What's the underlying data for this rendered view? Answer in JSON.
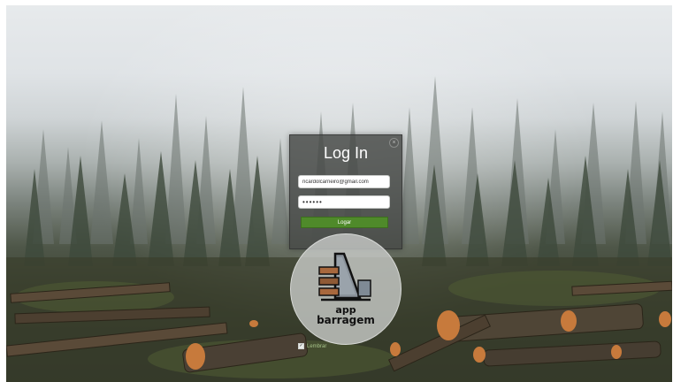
{
  "login": {
    "title": "Log In",
    "email_value": "ricardolcarneiro@gmail.com",
    "password_value": "••••••",
    "submit_label": "Logar",
    "close_symbol": "×",
    "remember_label": "Lembrar"
  },
  "logo": {
    "line1": "app",
    "line2": "barragem"
  },
  "colors": {
    "submit": "#4f8a2a",
    "panel": "#464846",
    "logo_wood": "#a8683d",
    "logo_gray": "#7f8a95"
  },
  "icons": {
    "close": "close-icon",
    "remember": "checkbox-icon"
  }
}
